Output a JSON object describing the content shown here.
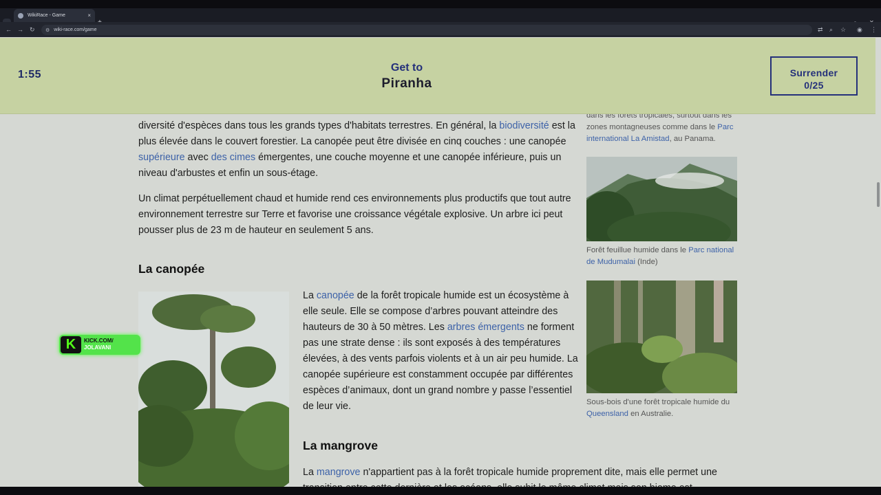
{
  "browser": {
    "tab_title": "WikiRace - Game",
    "tab_close": "×",
    "new_tab": "+",
    "url": "wiki-race.com/game"
  },
  "game": {
    "timer": "1:55",
    "get_to_label": "Get to",
    "target": "Piranha",
    "surrender_label": "Surrender",
    "progress": "0/25"
  },
  "article": {
    "p1_line0": "diversité d'espèces dans tous les grands types d'habitats terrestres. En général, la",
    "p1_link_biodiv": "biodiversité",
    "p1_line0_end": "est la",
    "p1_line1": "plus élevée dans le couvert forestier. La canopée peut être divisée en cinq couches : une canopée",
    "p1_link_superieure": "supérieure",
    "p1_line2_mid": "avec",
    "p1_link_cimes": "des cimes",
    "p1_line2_end": "émergentes, une couche moyenne et une canopée inférieure, puis un",
    "p1_line3": "niveau d'arbustes et enfin un sous-étage.",
    "p2_line0": "Un climat perpétuellement chaud et humide rend ces environnements plus productifs que tout autre",
    "p2_line1": "environnement terrestre sur Terre et favorise une croissance végétale explosive. Un arbre ici peut",
    "p2_line2": "pousser plus de 23 m de hauteur en seulement 5 ans.",
    "h_canopee": "La canopée",
    "c_line0_a": "La",
    "c_link_canopee": "canopée",
    "c_line0_b": "de la forêt tropicale humide est un écosystème à",
    "c_line1": "elle seule. Elle se compose d’arbres pouvant atteindre des",
    "c_line2_a": "hauteurs de 30 à 50 mètres. Les",
    "c_link_arbres": "arbres émergents",
    "c_line2_b": "ne forment",
    "c_line3": "pas une strate dense : ils sont exposés à des températures",
    "c_line4": "élevées, à des vents parfois violents et à un air peu humide. La",
    "c_line5": "canopée supérieure est constamment occupée par différentes",
    "c_line6": "espèces d’animaux, dont un grand nombre y passe l’essentiel",
    "c_line7": "de leur vie.",
    "h_mangrove": "La mangrove",
    "m_line0_a": "La",
    "m_link_mangrove": "mangrove",
    "m_line0_b": "n'appartient pas à la forêt tropicale humide proprement dite, mais elle permet une",
    "m_line1": "transition entre cette dernière et les océans, elle subit le même climat mais son biome est différent"
  },
  "sidebar": {
    "cap0_line0": "dans les forêts tropicales, surtout dans les",
    "cap0_line1_a": "zones montagneuses comme dans le",
    "cap0_link_a": "Parc",
    "cap0_link_b": "international La Amistad",
    "cap0_line2_end": ", au Panama.",
    "cap1_line0_a": "Forêt feuillue humide dans le",
    "cap1_link_a": "Parc national",
    "cap1_link_b": "de Mudumalai",
    "cap1_line1_end": "(Inde)",
    "cap2_line0": "Sous-bois d'une forêt tropicale humide du",
    "cap2_link": "Queensland",
    "cap2_line1_end": "en Australie."
  },
  "overlay": {
    "kick_logo": "K",
    "kick_line1": "KICK.COM/",
    "kick_line2": "JOLAVANI"
  },
  "colors": {
    "header_bg": "#c6d2a2",
    "accent": "#24307a",
    "link": "#3d62a8",
    "page_bg": "#d5d8d3"
  }
}
